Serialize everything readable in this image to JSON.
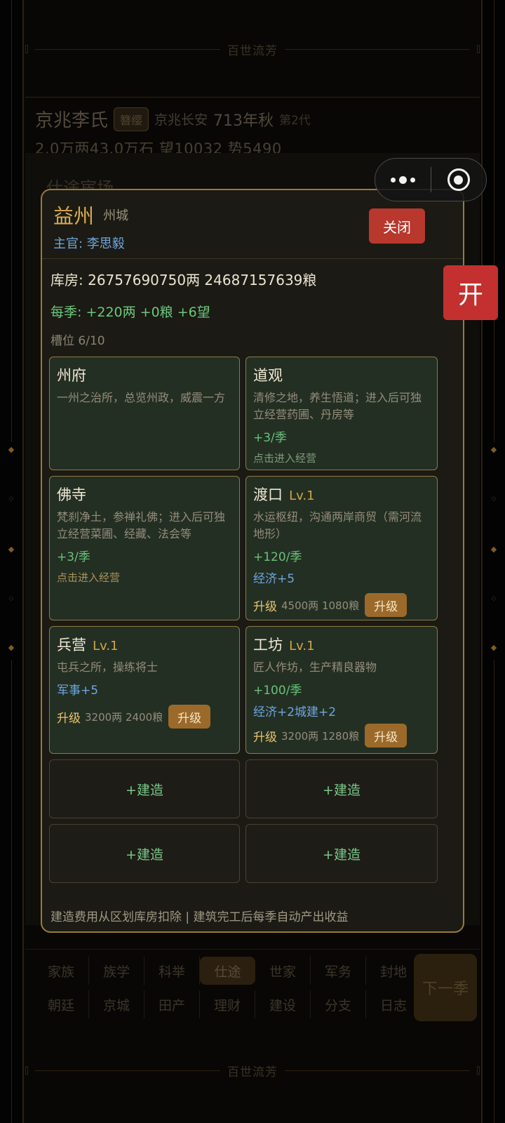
{
  "app": {
    "banner_title": "百世流芳",
    "family": "京兆李氏",
    "rank": "簪缨",
    "location": "京兆长安",
    "year": "713年秋",
    "generation": "第2代",
    "resources": "2.0万两43.0万石  望10032 势5490",
    "section_title": "仕途宦场",
    "nav_row1": [
      "家族",
      "族学",
      "科举",
      "仕途",
      "世家",
      "军务",
      "封地"
    ],
    "nav_row2": [
      "朝廷",
      "京城",
      "田产",
      "理财",
      "建设",
      "分支",
      "日志"
    ],
    "next_season": "下一季",
    "open_button": "开"
  },
  "modal": {
    "city": "益州",
    "city_type": "州城",
    "governor": "主官: 李思毅",
    "close_label": "关闭",
    "storage": "库房: 26757690750两 24687157639粮",
    "income": "每季: +220两 +0粮 +6望",
    "slots": "槽位 6/10",
    "footer": "建造费用从区划库房扣除 | 建筑完工后每季自动产出收益"
  },
  "buildings": [
    {
      "title": "州府",
      "desc": "一州之治所，总览州政，威震一方"
    },
    {
      "title": "道观",
      "desc": "清修之地，养生悟道；进入后可独立经营药圃、丹房等",
      "yield": "+3/季",
      "enter": "点击进入经营"
    },
    {
      "title": "佛寺",
      "desc": "梵刹净土，参禅礼佛；进入后可独立经营菜圃、经藏、法会等",
      "yield": "+3/季",
      "enter": "点击进入经营"
    },
    {
      "title": "渡口",
      "level": "Lv.1",
      "desc": "水运枢纽，沟通两岸商贸（需河流地形）",
      "yield": "+120/季",
      "bonus": "经济+5",
      "upgrade_label": "升级",
      "upgrade_cost": "4500两 1080粮",
      "upgrade_button": "升级"
    },
    {
      "title": "兵营",
      "level": "Lv.1",
      "desc": "屯兵之所，操练将士",
      "bonus": "军事+5",
      "upgrade_label": "升级",
      "upgrade_cost": "3200两 2400粮",
      "upgrade_button": "升级"
    },
    {
      "title": "工坊",
      "level": "Lv.1",
      "desc": "匠人作坊，生产精良器物",
      "yield": "+100/季",
      "bonus": "经济+2城建+2",
      "upgrade_label": "升级",
      "upgrade_cost": "3200两 1280粮",
      "upgrade_button": "升级"
    }
  ],
  "build_label": "+建造",
  "icons": {
    "menu": "more-dots-icon",
    "close": "target-icon"
  },
  "colors": {
    "gold": "#d9ab4d",
    "green": "#6cc77c",
    "blue": "#6fa6df",
    "red": "#c4302f",
    "brown": "#9b6a2b"
  }
}
